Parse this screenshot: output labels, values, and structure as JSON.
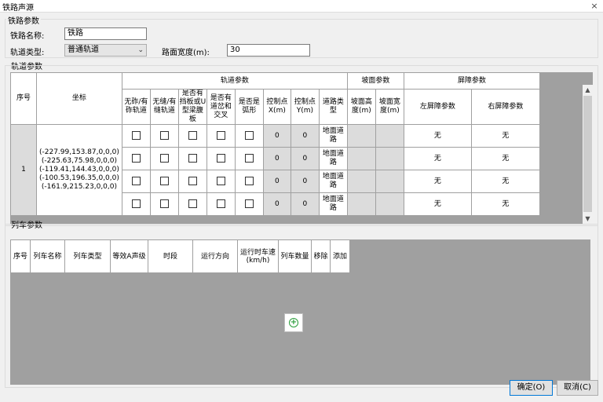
{
  "window": {
    "title": "铁路声源",
    "close_icon": "×"
  },
  "railway_params": {
    "group_label": "铁路参数",
    "name_label": "铁路名称:",
    "name_value": "铁路",
    "track_type_label": "轨道类型:",
    "track_type_value": "普通轨道",
    "road_width_label": "路面宽度(m):",
    "road_width_value": "30"
  },
  "track_params": {
    "group_label": "轨道参数",
    "headers": {
      "seq": "序号",
      "coord": "坐标",
      "track_group": "轨道参数",
      "track_cols": [
        "无砟/有砟轨道",
        "无缝/有缝轨道",
        "是否有挡板或U型梁腹板",
        "是否有道岔和交叉",
        "是否是弧形",
        "控制点X(m)",
        "控制点Y(m)",
        "道路类型"
      ],
      "bed_group": "坡面参数",
      "bed_cols": [
        "坡面高度(m)",
        "坡面宽度(m)"
      ],
      "barrier_group": "屏障参数",
      "barrier_cols": [
        "左屏障参数",
        "右屏障参数"
      ]
    },
    "rows": [
      {
        "seq": "1",
        "coord": "(-227.99,153.87,0,0,0)(-225.63,75.98,0,0,0)(-119.41,144.43,0,0,0)(-100.53,196.35,0,0,0)(-161.9,215.23,0,0,0)",
        "segments": [
          {
            "x": "0",
            "y": "0",
            "road_type": "地面道路",
            "left": "无",
            "right": "无"
          },
          {
            "x": "0",
            "y": "0",
            "road_type": "地面道路",
            "left": "无",
            "right": "无"
          },
          {
            "x": "0",
            "y": "0",
            "road_type": "地面道路",
            "left": "无",
            "right": "无"
          },
          {
            "x": "0",
            "y": "0",
            "road_type": "地面道路",
            "left": "无",
            "right": "无"
          }
        ]
      }
    ]
  },
  "train_params": {
    "group_label": "列车参数",
    "headers": [
      "序号",
      "列车名称",
      "列车类型",
      "等效A声级",
      "时段",
      "运行方向",
      "运行时车速(km/h)",
      "列车数量",
      "移除",
      "添加"
    ]
  },
  "buttons": {
    "ok": "确定(O)",
    "cancel": "取消(C)"
  }
}
